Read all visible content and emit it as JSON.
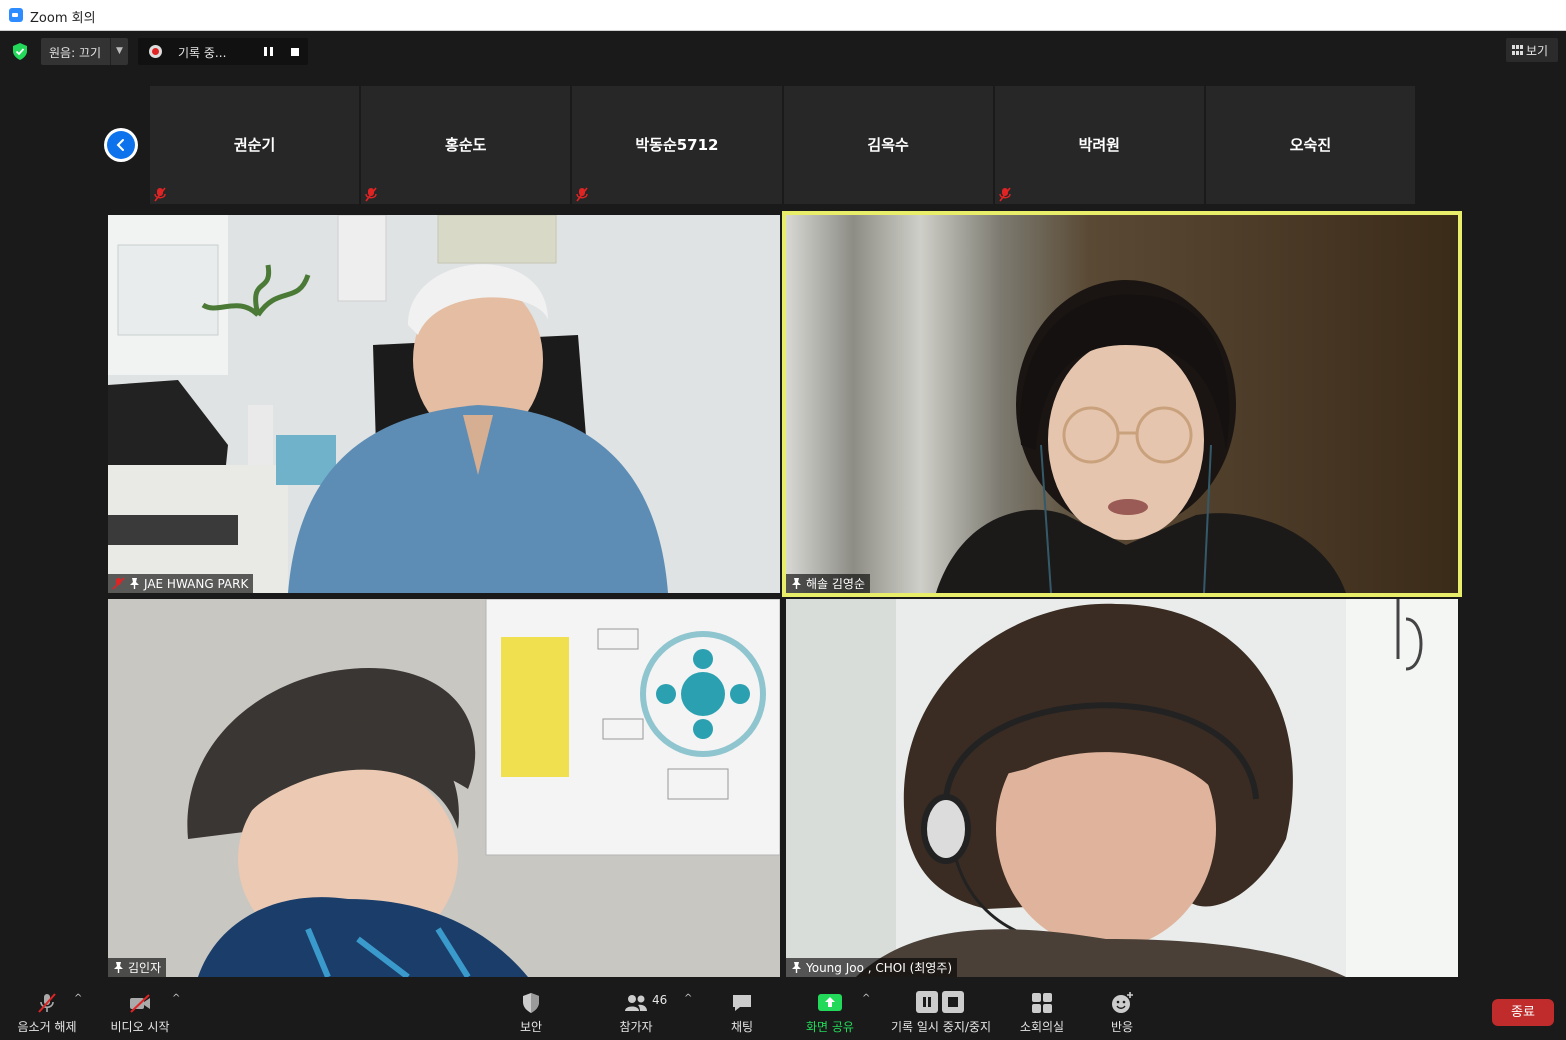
{
  "window": {
    "title": "Zoom 회의"
  },
  "topbar": {
    "audio_option": "원음: 끄기",
    "recording_status": "기록 중...",
    "view_label": "보기"
  },
  "thumbnails": [
    {
      "name": "권순기",
      "muted": true
    },
    {
      "name": "홍순도",
      "muted": true
    },
    {
      "name": "박동순5712",
      "muted": true
    },
    {
      "name": "김옥수",
      "muted": false
    },
    {
      "name": "박려원",
      "muted": true
    },
    {
      "name": "오숙진",
      "muted": false
    }
  ],
  "videos": [
    {
      "name": "JAE HWANG PARK",
      "muted": true,
      "pinned": true
    },
    {
      "name": "해솔 김영순",
      "muted": false,
      "pinned": true,
      "active_speaker": true
    },
    {
      "name": "김인자",
      "muted": false,
      "pinned": true
    },
    {
      "name": "Young Joo , CHOI (최영주)",
      "muted": false,
      "pinned": true
    }
  ],
  "toolbar": {
    "unmute": "음소거 해제",
    "start_video": "비디오 시작",
    "security": "보안",
    "participants": "참가자",
    "participant_count": "46",
    "chat": "채팅",
    "share_screen": "화면 공유",
    "recording_controls": "기록 일시 중지/중지",
    "breakout_rooms": "소회의실",
    "reactions": "반응",
    "end": "종료"
  },
  "colors": {
    "active_speaker_border": "#e8ee6a",
    "share_green": "#23d959",
    "end_red": "#c02b2b",
    "accent_blue": "#0e72ed"
  }
}
